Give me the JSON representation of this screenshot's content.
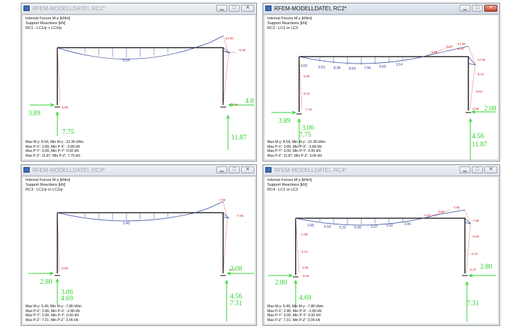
{
  "windows": [
    {
      "title": "RFEM-MODELLDATEI, RC1*",
      "header_lines": [
        "Internal Forces M-y [kNm]",
        "Support Reactions [kN]",
        "RC1 : LC1/p + LC2/p"
      ],
      "summary_lines": [
        "Max M-y: 8.54, Min M-y: -12.36 kNm",
        "Max P-X': 3.89, Min P-X': -3.89 kN",
        "Max P-Y': 0.00, Min P-Y': 0.00 kN",
        "Max P-Z': 11.87, Min P-Z': 7.75 kN"
      ],
      "beam_labels": [
        "8.54"
      ],
      "red_labels": [
        "-12.36",
        "-6.36",
        "-3.89",
        "-6.36"
      ],
      "reactions": [
        "3.89",
        "7.75",
        "4.8",
        "11.87"
      ]
    },
    {
      "title": "RFEM-MODELLDATEI, RC2*",
      "header_lines": [
        "Internal Forces M-y [kNm]",
        "Support Reactions [kN]",
        "RC2 : LC1 or LC2"
      ],
      "summary_lines": [
        "Max M-y: 8.54, Min M-y: -12.36 kNm",
        "Max P-X': 3.89, Min P-X': -3.89 kN",
        "Max P-Y': 0.00, Min P-Y': 0.00 kN",
        "Max P-Z': 11.87, Min P-Z': 3.06 kN"
      ],
      "beam_labels": [
        "3.62",
        "6.51",
        "8.38",
        "8.54",
        "7.96",
        "5.65",
        "3.14"
      ],
      "red_labels": [
        "-12.36",
        "-6.36",
        "-6.67",
        "-5.90",
        "-12.36",
        "-9.10",
        "-5.64",
        "-2.90",
        "-2.59",
        "-8.16",
        "-7.75"
      ],
      "reactions": [
        "3.89",
        "3.06",
        "7.75",
        "2.08",
        "4.56",
        "11.87"
      ]
    },
    {
      "title": "RFEM-MODELLDATEI, RC3*",
      "header_lines": [
        "Internal Forces M-y [kNm]",
        "Support Reactions [kN]",
        "RC3 : LC1/p or LC2/p"
      ],
      "summary_lines": [
        "Max M-y: 5.49, Min M-y: -7.86 kNm",
        "Max P-X': 2.80, Min P-X': -2.80 kN",
        "Max P-Y': 0.00, Min P-Y': 0.00 kN",
        "Max P-Z': 7.31, Min P-Z': 3.06 kN"
      ],
      "beam_labels": [
        "5.49"
      ],
      "red_labels": [
        "-7.86",
        "-7.86",
        "-5.59",
        "-2.27"
      ],
      "reactions": [
        "2.80",
        "3.06",
        "4.69",
        "2.08",
        "4.56",
        "7.31"
      ]
    },
    {
      "title": "RFEM-MODELLDATEI, RC4*",
      "header_lines": [
        "Internal Forces M-y [kNm]",
        "Support Reactions [kN]",
        "RC4 : LC1 or LC2"
      ],
      "summary_lines": [
        "Max M-y: 5.49, Min M-y: -7.86 kNm",
        "Max P-X': 2.80, Min P-X': -2.80 kN",
        "Max P-Y': 0.00, Min P-Y': 0.00 kN",
        "Max P-Z': 7.31, Min P-Z': 3.06 kN"
      ],
      "beam_labels": [
        "2.45",
        "4.18",
        "5.23",
        "5.49",
        "5.07",
        "3.92",
        "2.06"
      ],
      "red_labels": [
        "-7.86",
        "-3.94",
        "-2.01",
        "-7.86",
        "-6.00",
        "-4.12",
        "-2.27",
        "-1.98",
        "-3.21",
        "-4.86",
        "-5.66"
      ],
      "reactions": [
        "2.80",
        "4.69",
        "2.80",
        "7.31"
      ]
    }
  ],
  "colors": {
    "moment_line": "#2b3f9a",
    "reaction": "#2fd22f",
    "red": "#d02020",
    "frame": "#000000"
  },
  "icons": {
    "minimize": "minimize-icon",
    "maximize": "maximize-icon",
    "close": "close-icon"
  }
}
